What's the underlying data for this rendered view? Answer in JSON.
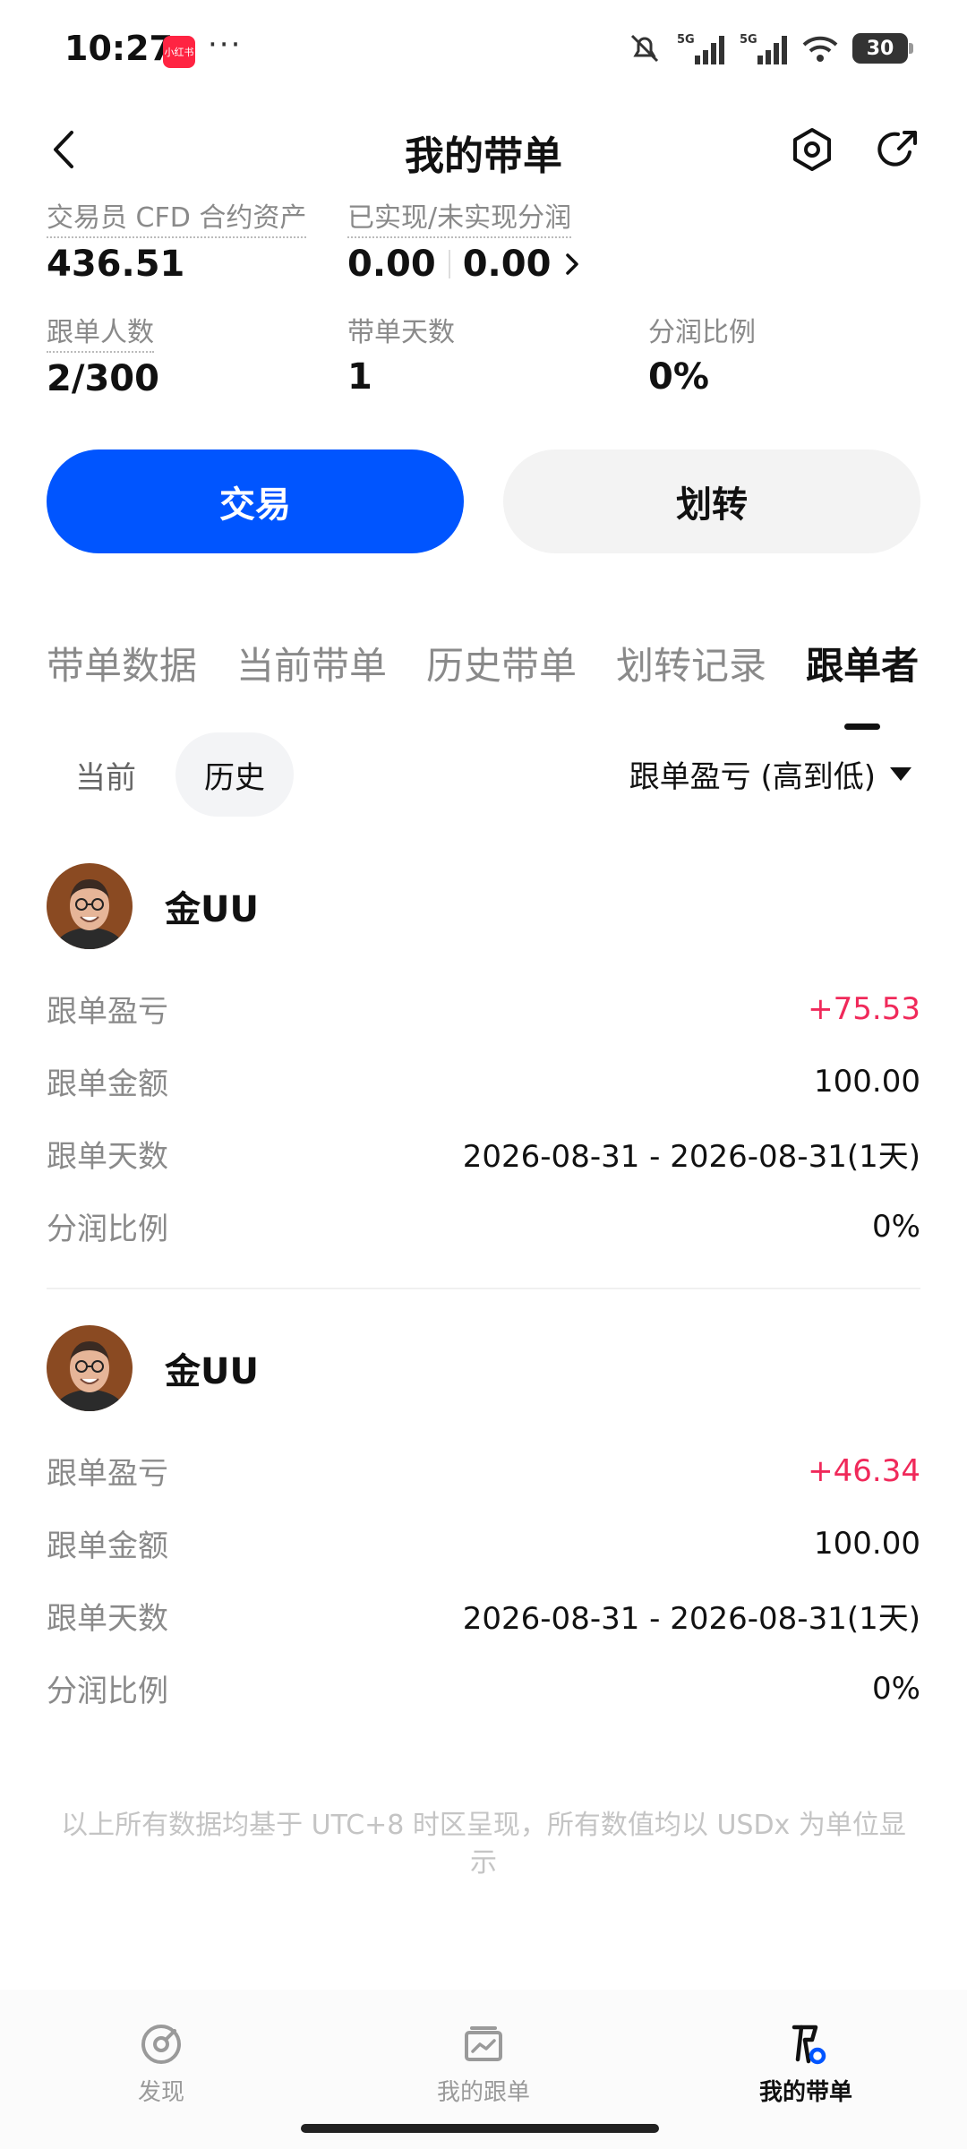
{
  "status_bar": {
    "time": "10:27",
    "app_badge": "小红书",
    "more": "···",
    "signal_1": "5G",
    "signal_2": "5G",
    "battery": "30"
  },
  "header": {
    "title": "我的带单",
    "icons": [
      "back-icon",
      "settings-icon",
      "share-icon"
    ]
  },
  "stats": {
    "cfd_assets_label": "交易员 CFD 合约资产",
    "cfd_assets_value": "436.51",
    "profit_share_label": "已实现/未实现分润",
    "realized": "0.00",
    "unrealized": "0.00",
    "followers_label": "跟单人数",
    "followers_value": "2/300",
    "days_label": "带单天数",
    "days_value": "1",
    "ratio_label": "分润比例",
    "ratio_value": "0%"
  },
  "actions": {
    "trade": "交易",
    "transfer": "划转"
  },
  "tabs": [
    "带单数据",
    "当前带单",
    "历史带单",
    "划转记录",
    "跟单者"
  ],
  "subtabs": {
    "current": "当前",
    "history": "历史",
    "sort": "跟单盈亏 (高到低)"
  },
  "records": [
    {
      "name": "金UU",
      "pnl_label": "跟单盈亏",
      "pnl": "+75.53",
      "amount_label": "跟单金额",
      "amount": "100.00",
      "days_label": "跟单天数",
      "days": "2026-08-31 - 2026-08-31(1天)",
      "ratio_label": "分润比例",
      "ratio": "0%"
    },
    {
      "name": "金UU",
      "pnl_label": "跟单盈亏",
      "pnl": "+46.34",
      "amount_label": "跟单金额",
      "amount": "100.00",
      "days_label": "跟单天数",
      "days": "2026-08-31 - 2026-08-31(1天)",
      "ratio_label": "分润比例",
      "ratio": "0%"
    }
  ],
  "footnote": "以上所有数据均基于 UTC+8 时区呈现，所有数值均以 USDx 为单位显示",
  "bottom_nav": [
    {
      "label": "发现",
      "icon": "discover-icon"
    },
    {
      "label": "我的跟单",
      "icon": "copy-trade-icon"
    },
    {
      "label": "我的带单",
      "icon": "lead-trade-icon"
    }
  ],
  "colors": {
    "accent": "#0055ff",
    "profit": "#f0295a"
  }
}
